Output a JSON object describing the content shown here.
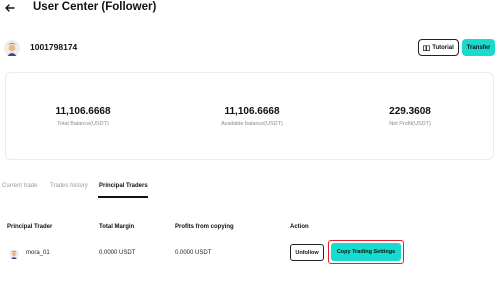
{
  "header": {
    "title": "User Center (Follower)",
    "back_icon": "arrow-left-icon"
  },
  "user": {
    "id": "1001798174"
  },
  "buttons": {
    "tutorial": "Tutorial",
    "transfer": "Transfer"
  },
  "colors": {
    "accent": "#18dbcf",
    "highlight": "#e0212a"
  },
  "stats": {
    "total_balance": {
      "value": "11,106.6668",
      "label": "Total Balance(USDT)"
    },
    "available_balance": {
      "value": "11,106.6668",
      "label": "Available balance(USDT)"
    },
    "net_profit": {
      "value": "229.3608",
      "label": "Net Profit(USDT)"
    }
  },
  "tabs": [
    {
      "label": "Current trade",
      "active": false
    },
    {
      "label": "Trades history",
      "active": false
    },
    {
      "label": "Principal Traders",
      "active": true
    }
  ],
  "table": {
    "headers": [
      "Principal Trader",
      "Total Margin",
      "Profits from copying",
      "Action"
    ],
    "rows": [
      {
        "trader": "mora_01",
        "total_margin": "0.0000 USDT",
        "profits": "0.0000 USDT",
        "unfollow": "Unfollow",
        "copy_settings": "Copy Trading Settings"
      }
    ]
  }
}
